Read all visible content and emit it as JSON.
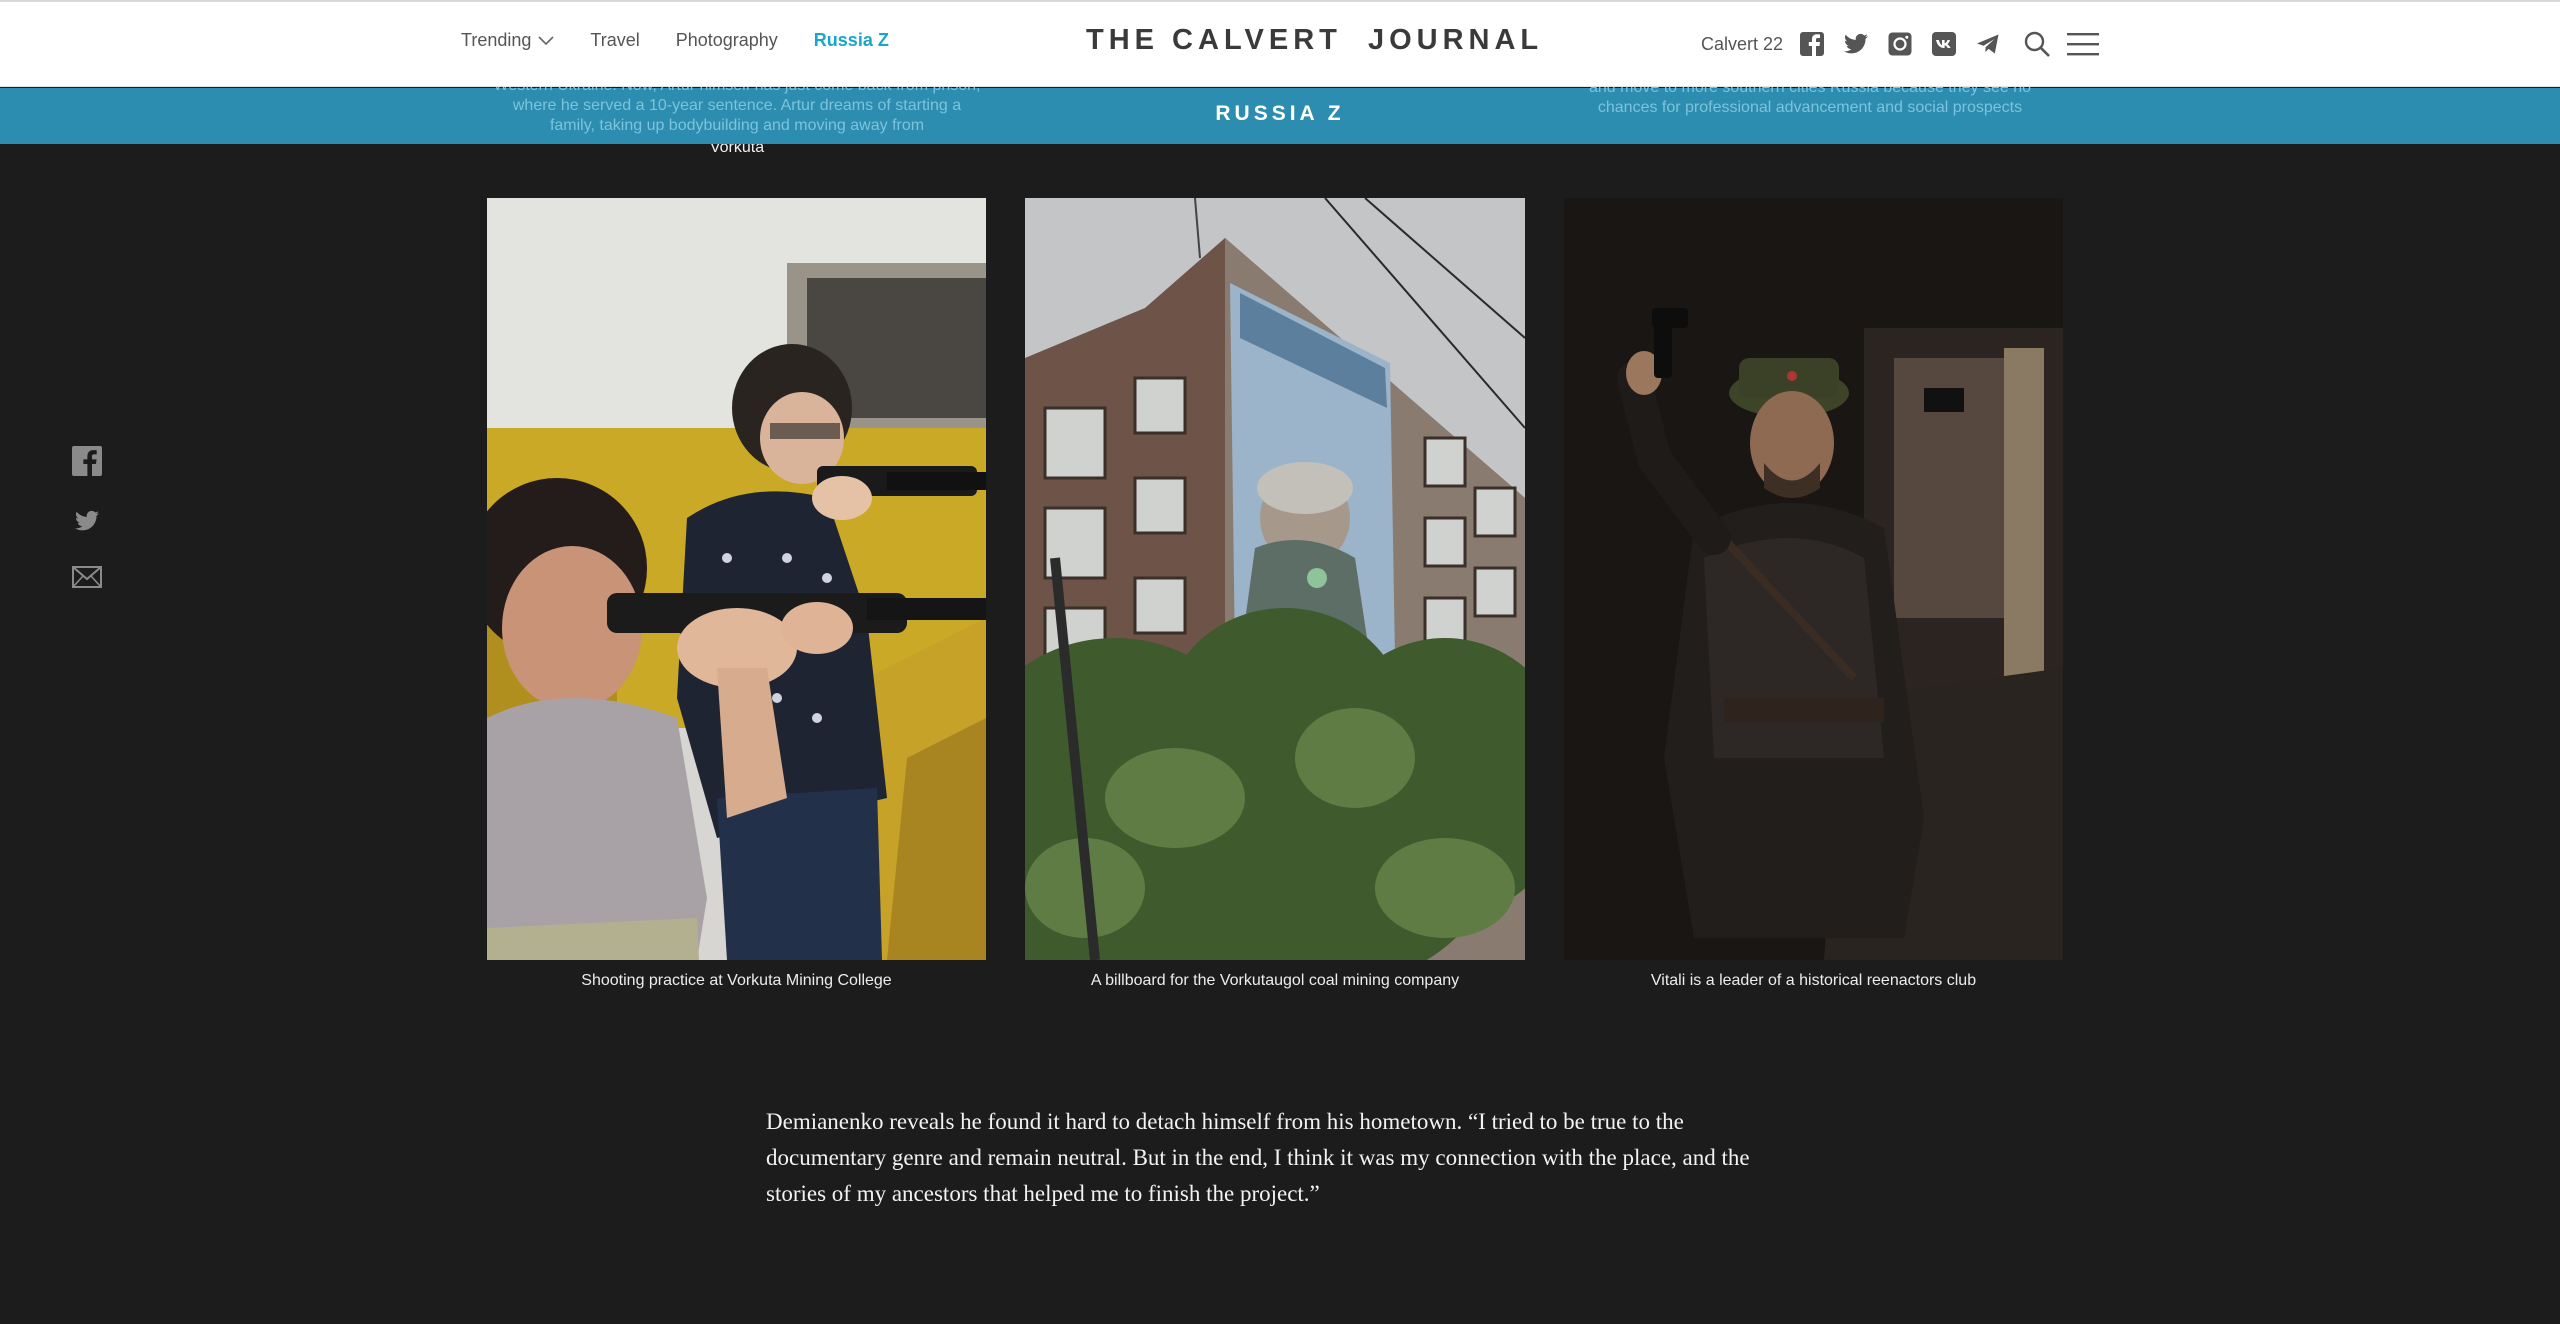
{
  "nav": {
    "items": [
      {
        "label": "Trending"
      },
      {
        "label": "Travel"
      },
      {
        "label": "Photography"
      },
      {
        "label": "Russia Z"
      }
    ],
    "logo": "THE CALVERT  JOURNAL",
    "calvert22": "Calvert 22",
    "icons": [
      "facebook-icon",
      "twitter-icon",
      "instagram-icon",
      "vk-icon",
      "telegram-icon",
      "search-icon",
      "menu-icon"
    ]
  },
  "section": {
    "label": "RUSSIA Z",
    "peek_left": "Western Ukraine. Now, Artur himself has just come back from prison, where he served a 10-year sentence. Artur dreams of starting a family, taking up bodybuilding and moving away from",
    "peek_left_tail": "Vorkuta",
    "peek_right": "and move to more southern cities Russia because they see no chances for professional advancement and social prospects"
  },
  "share": [
    "facebook-icon",
    "twitter-icon",
    "email-icon"
  ],
  "gallery": [
    {
      "caption": "Shooting practice at Vorkuta Mining College"
    },
    {
      "caption": "A billboard for the Vorkutaugol coal mining company"
    },
    {
      "caption": "Vitali is a leader of a historical reenactors club"
    }
  ],
  "body": {
    "paragraph": "Demianenko reveals he found it hard to detach himself from his hometown. “I tried to be true to the documentary genre and remain neutral. But in the end, I think it was my connection with the place, and the stories of my ancestors that helped me to finish the project.”"
  },
  "colors": {
    "accent": "#1aa6c6",
    "section_bar": "#2d8db0",
    "background": "#1c1c1c"
  }
}
